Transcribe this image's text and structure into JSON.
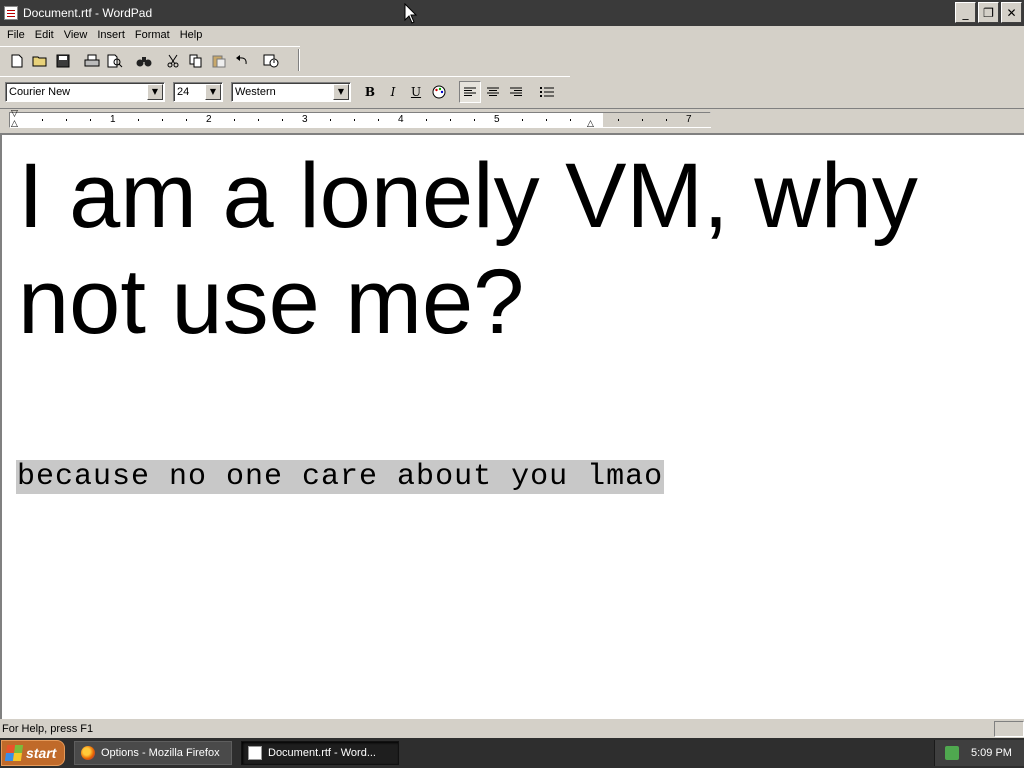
{
  "window": {
    "title": "Document.rtf - WordPad",
    "minimize": "_",
    "maximize": "❐",
    "close": "✕"
  },
  "menu": [
    "File",
    "Edit",
    "View",
    "Insert",
    "Format",
    "Help"
  ],
  "toolbar": {
    "new_icon": "new-document-icon",
    "open_icon": "open-folder-icon",
    "save_icon": "save-disk-icon",
    "print_icon": "printer-icon",
    "preview_icon": "print-preview-icon",
    "find_icon": "binoculars-icon",
    "cut_icon": "scissors-icon",
    "copy_icon": "copy-icon",
    "paste_icon": "paste-icon",
    "undo_icon": "undo-icon",
    "datetime_icon": "date-time-icon"
  },
  "format": {
    "font": "Courier New",
    "size": "24",
    "script": "Western",
    "bold": "B",
    "italic": "I",
    "underline": "U",
    "alignment": "left"
  },
  "ruler": {
    "numbers": [
      "1",
      "2",
      "3",
      "4",
      "5",
      "7"
    ]
  },
  "document": {
    "heading": "I am a lonely VM, why not use me?",
    "body": "because no one care about you lmao",
    "highlight_color": "#c8c8c8"
  },
  "status": {
    "text": "For Help, press F1"
  },
  "taskbar": {
    "start": "start",
    "tasks": [
      {
        "label": "Options - Mozilla Firefox",
        "active": false
      },
      {
        "label": "Document.rtf - Word...",
        "active": true
      }
    ],
    "clock": "5:09 PM"
  }
}
